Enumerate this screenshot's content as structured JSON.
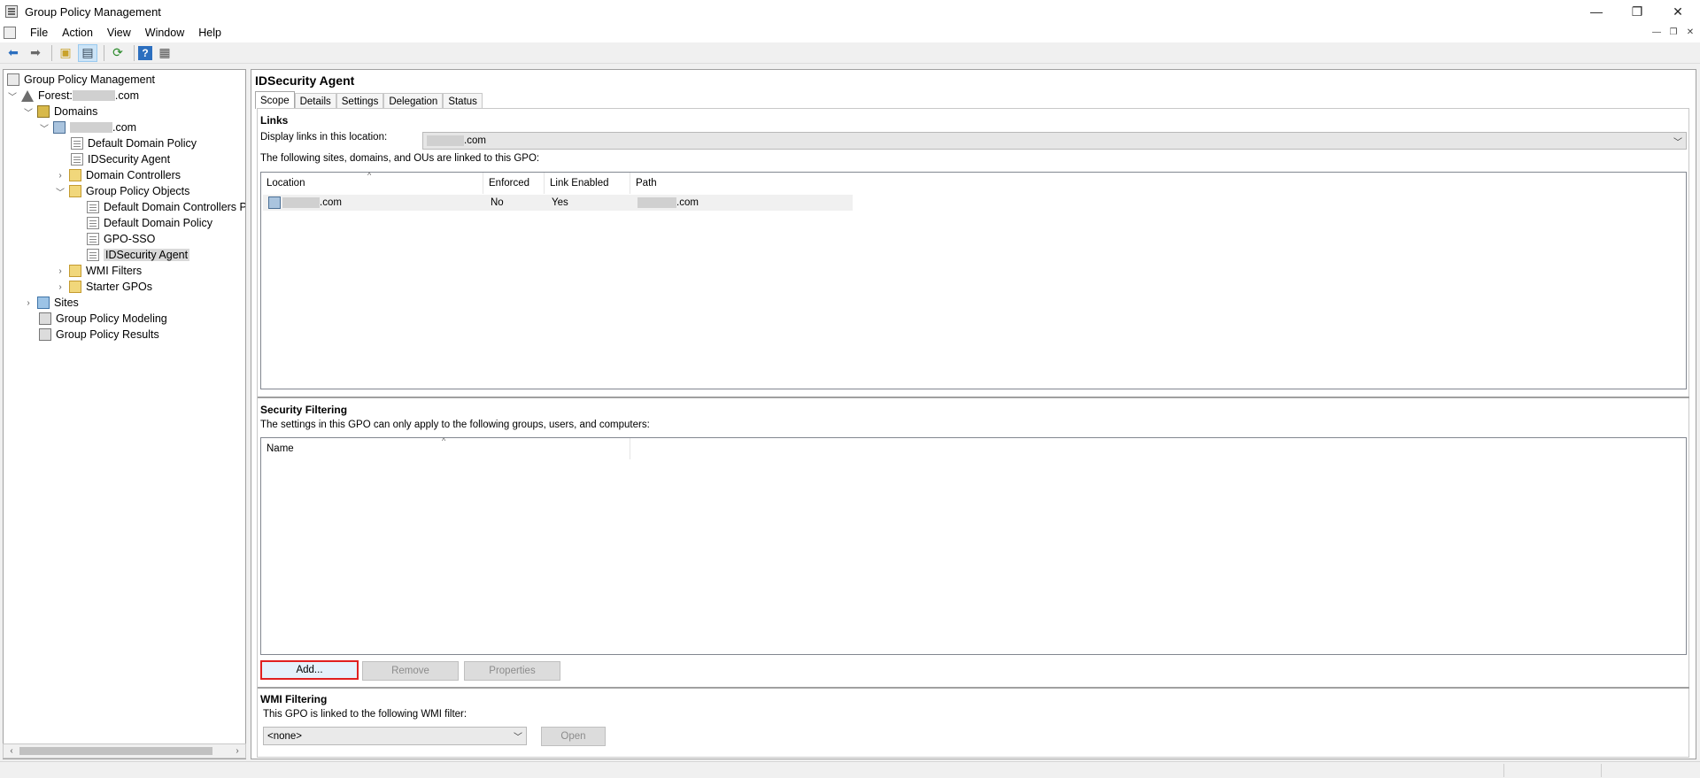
{
  "window": {
    "title": "Group Policy Management",
    "controls": [
      "minimize",
      "restore",
      "close"
    ]
  },
  "menu": [
    "File",
    "Action",
    "View",
    "Window",
    "Help"
  ],
  "toolbar": {
    "icons": [
      "back-arrow-icon",
      "forward-arrow-icon",
      "up-folder-icon",
      "show-hide-tree-icon",
      "refresh-icon",
      "help-icon",
      "properties-icon"
    ]
  },
  "tree": {
    "root": "Group Policy Management",
    "forest_label": "Forest: ",
    "forest_suffix": ".com",
    "domains": "Domains",
    "domain_suffix": ".com",
    "items": [
      "Default Domain Policy",
      "IDSecurity Agent",
      "Domain Controllers",
      "Group Policy Objects",
      "Default Domain Controllers P",
      "Default Domain Policy",
      "GPO-SSO",
      "IDSecurity Agent",
      "WMI Filters",
      "Starter GPOs"
    ],
    "sites": "Sites",
    "modeling": "Group Policy Modeling",
    "results": "Group Policy Results"
  },
  "main": {
    "gpo_title": "IDSecurity Agent",
    "tabs": [
      "Scope",
      "Details",
      "Settings",
      "Delegation",
      "Status"
    ],
    "active_tab": "Scope",
    "links": {
      "header": "Links",
      "display_label": "Display links in this location:",
      "location_suffix": ".com",
      "linked_text": "The following sites, domains, and OUs are linked to this GPO:",
      "columns": [
        "Location",
        "Enforced",
        "Link Enabled",
        "Path"
      ],
      "rows": [
        {
          "location_suffix": ".com",
          "enforced": "No",
          "link_enabled": "Yes",
          "path_suffix": ".com"
        }
      ]
    },
    "security": {
      "header": "Security Filtering",
      "desc": "The settings in this GPO can only apply to the following groups, users, and computers:",
      "columns": [
        "Name"
      ],
      "buttons": {
        "add": "Add...",
        "remove": "Remove",
        "properties": "Properties"
      }
    },
    "wmi": {
      "header": "WMI Filtering",
      "desc": "This GPO is linked to the following WMI filter:",
      "selected": "<none>",
      "open": "Open"
    }
  }
}
